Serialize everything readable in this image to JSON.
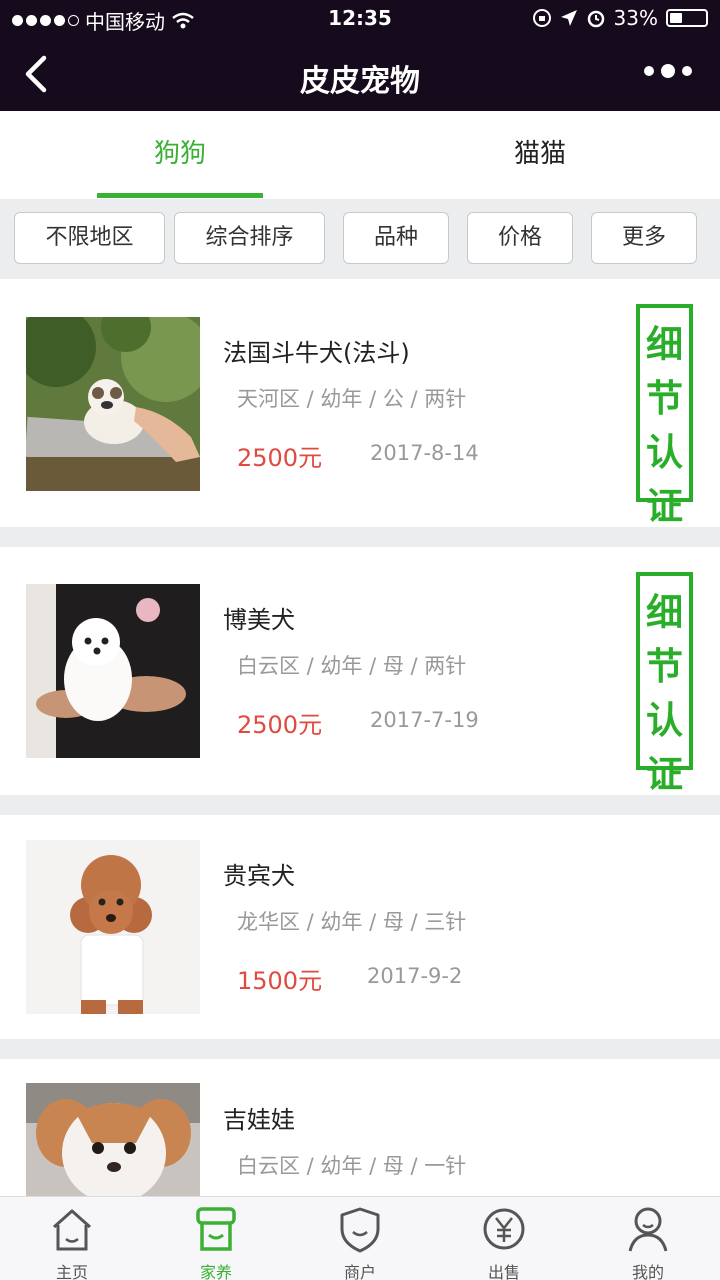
{
  "status_bar": {
    "carrier": "中国移动",
    "time": "12:35",
    "battery": "33%"
  },
  "navbar": {
    "title": "皮皮宠物"
  },
  "tabs": [
    {
      "label": "狗狗",
      "active": true
    },
    {
      "label": "猫猫",
      "active": false
    }
  ],
  "filters": [
    "不限地区",
    "综合排序",
    "品种",
    "价格",
    "更多"
  ],
  "listings": [
    {
      "name": "法国斗牛犬(法斗)",
      "meta": "天河区 / 幼年 / 公 / 两针",
      "price": "2500元",
      "date": "2017-8-14",
      "badge": [
        "细",
        "节",
        "认",
        "证"
      ]
    },
    {
      "name": "博美犬",
      "meta": "白云区 / 幼年 / 母 / 两针",
      "price": "2500元",
      "date": "2017-7-19",
      "badge": [
        "细",
        "节",
        "认",
        "证"
      ]
    },
    {
      "name": "贵宾犬",
      "meta": "龙华区 / 幼年 / 母 / 三针",
      "price": "1500元",
      "date": "2017-9-2"
    },
    {
      "name": "吉娃娃",
      "meta": "白云区 / 幼年 / 母 / 一针"
    }
  ],
  "tabbar": [
    {
      "label": "主页",
      "icon": "home-icon",
      "active": false
    },
    {
      "label": "家养",
      "icon": "shop-icon",
      "active": true
    },
    {
      "label": "商户",
      "icon": "shield-icon",
      "active": false
    },
    {
      "label": "出售",
      "icon": "yen-icon",
      "active": false
    },
    {
      "label": "我的",
      "icon": "user-icon",
      "active": false
    }
  ],
  "colors": {
    "accent": "#3ab034",
    "price": "#e04a3f",
    "header": "#150b1c"
  }
}
